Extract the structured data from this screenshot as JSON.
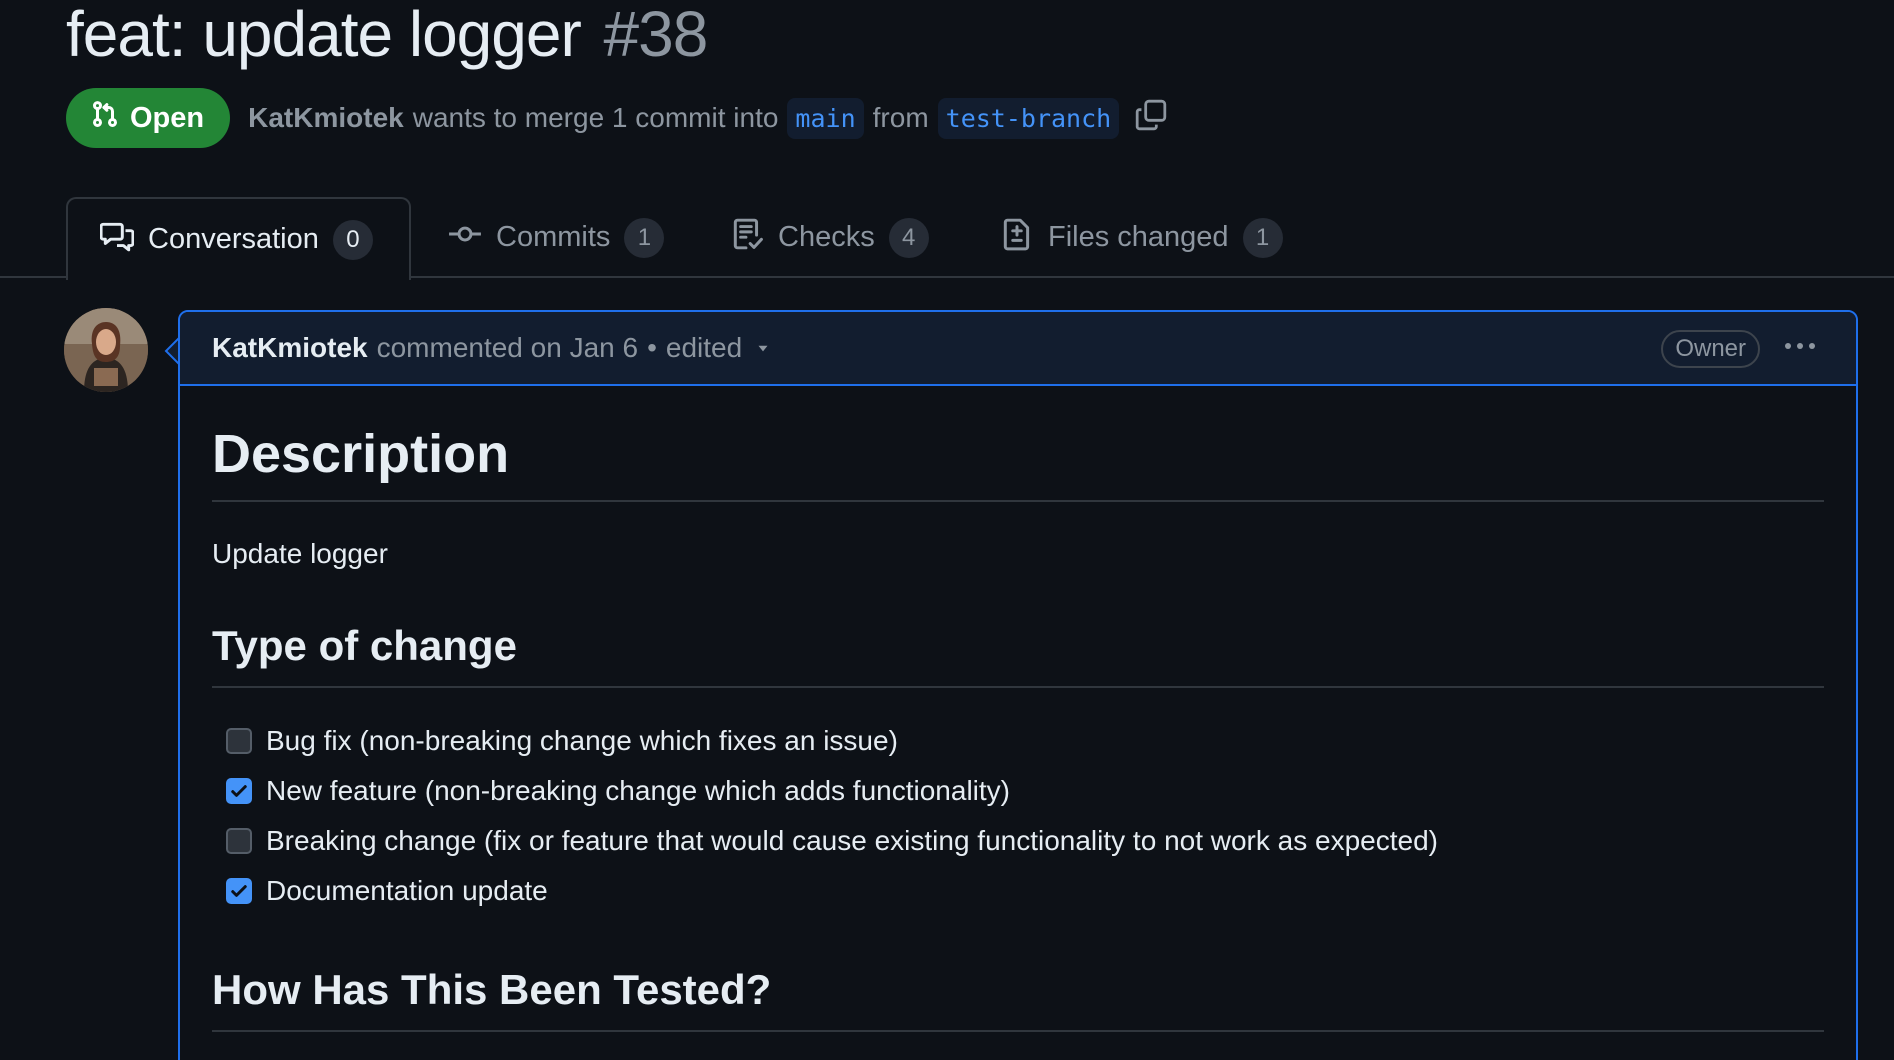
{
  "pr": {
    "title": "feat: update logger",
    "number": "#38",
    "state": "Open",
    "author": "KatKmiotek",
    "merge_text": "wants to merge 1 commit into",
    "base_branch": "main",
    "from_text": "from",
    "head_branch": "test-branch"
  },
  "tabs": [
    {
      "label": "Conversation",
      "count": "0",
      "icon": "comment-discussion-icon"
    },
    {
      "label": "Commits",
      "count": "1",
      "icon": "git-commit-icon"
    },
    {
      "label": "Checks",
      "count": "4",
      "icon": "checklist-icon"
    },
    {
      "label": "Files changed",
      "count": "1",
      "icon": "file-diff-icon"
    }
  ],
  "comment": {
    "author": "KatKmiotek",
    "action": "commented on Jan 6",
    "separator": "•",
    "edited": "edited",
    "role_label": "Owner",
    "body": {
      "heading": "Description",
      "paragraph": "Update logger",
      "change_heading": "Type of change",
      "checklist": [
        {
          "label": "Bug fix (non-breaking change which fixes an issue)",
          "checked": false
        },
        {
          "label": "New feature (non-breaking change which adds functionality)",
          "checked": true
        },
        {
          "label": "Breaking change (fix or feature that would cause existing functionality to not work as expected)",
          "checked": false
        },
        {
          "label": "Documentation update",
          "checked": true
        }
      ],
      "tested_heading": "How Has This Been Tested?"
    }
  },
  "colors": {
    "background": "#0d1117",
    "open_badge": "#238636",
    "accent_blue": "#4493f8",
    "comment_border": "#1f6feb",
    "muted_text": "#8d96a0"
  }
}
